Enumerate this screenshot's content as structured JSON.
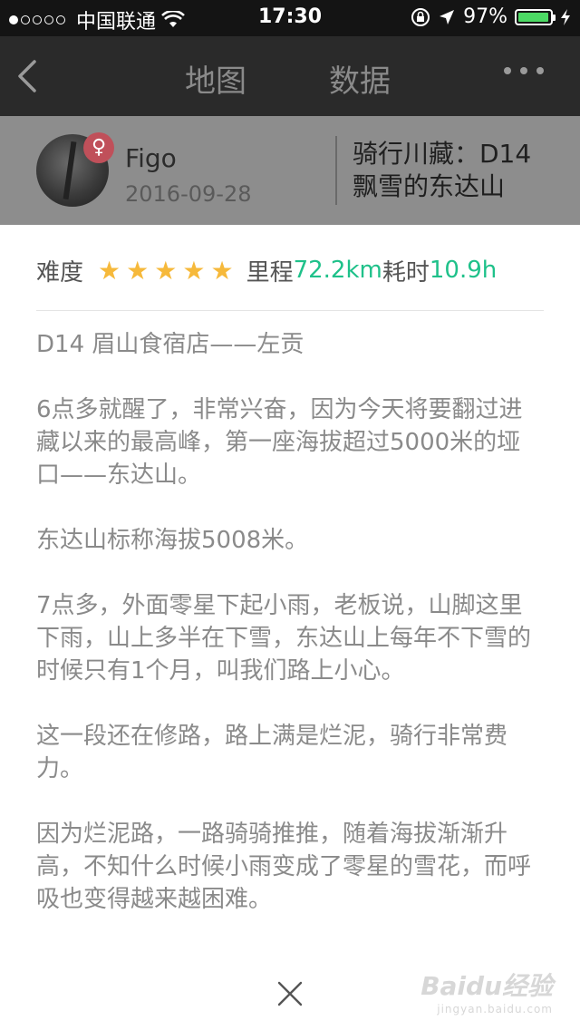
{
  "status_bar": {
    "carrier": "中国联通",
    "time": "17:30",
    "battery": "97%",
    "battery_level": 0.97
  },
  "nav": {
    "tab_map": "地图",
    "tab_data": "数据"
  },
  "header": {
    "user_name": "Figo",
    "date": "2016-09-28",
    "gender_symbol": "♀",
    "trip_title_line1": "骑行川藏：D14",
    "trip_title_line2": "飘雪的东达山"
  },
  "stats": {
    "difficulty_label": "难度",
    "difficulty_stars": 5,
    "distance_label": "里程",
    "distance_value": "72.2km",
    "time_label": "耗时",
    "time_value": "10.9h",
    "accent_color": "#1fc18a",
    "star_color": "#f6b93b"
  },
  "content": {
    "paragraphs": [
      "D14 眉山食宿店——左贡",
      "6点多就醒了，非常兴奋，因为今天将要翻过进藏以来的最高峰，第一座海拔超过5000米的垭口——东达山。",
      "东达山标称海拔5008米。",
      "7点多，外面零星下起小雨，老板说，山脚这里下雨，山上多半在下雪，东达山上每年不下雪的时候只有1个月，叫我们路上小心。",
      "这一段还在修路，路上满是烂泥，骑行非常费力。",
      "因为烂泥路，一路骑骑推推，随着海拔渐渐升高，不知什么时候小雨变成了零星的雪花，而呼吸也变得越来越困难。"
    ]
  },
  "watermark": {
    "title": "Baidu经验",
    "subtitle": "jingyan.baidu.com"
  }
}
